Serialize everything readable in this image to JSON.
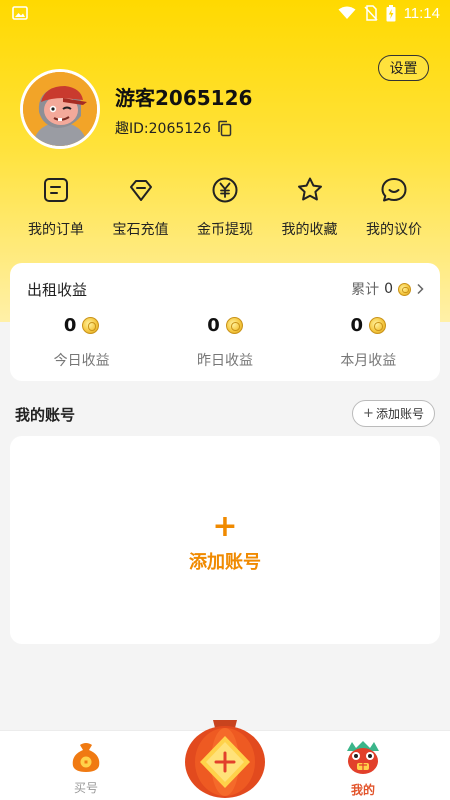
{
  "status_bar": {
    "time": "11:14"
  },
  "profile": {
    "settings_label": "设置",
    "username": "游客2065126",
    "id_label": "趣ID:2065126"
  },
  "menu": [
    {
      "label": "我的订单",
      "icon": "order-icon"
    },
    {
      "label": "宝石充值",
      "icon": "gem-icon"
    },
    {
      "label": "金币提现",
      "icon": "yen-coin-icon"
    },
    {
      "label": "我的收藏",
      "icon": "star-icon"
    },
    {
      "label": "我的议价",
      "icon": "chat-icon"
    }
  ],
  "earnings": {
    "title": "出租收益",
    "total_label": "累计",
    "total_value": "0",
    "items": [
      {
        "value": "0",
        "label": "今日收益"
      },
      {
        "value": "0",
        "label": "昨日收益"
      },
      {
        "value": "0",
        "label": "本月收益"
      }
    ]
  },
  "accounts": {
    "title": "我的账号",
    "add_small_label": "添加账号",
    "add_big_plus": "+",
    "add_big_label": "添加账号"
  },
  "tabbar": {
    "buy_label": "买号",
    "mine_label": "我的"
  },
  "colors": {
    "brand_yellow": "#ffd900",
    "accent_orange": "#f08a00",
    "active_tab": "#e2542b"
  }
}
